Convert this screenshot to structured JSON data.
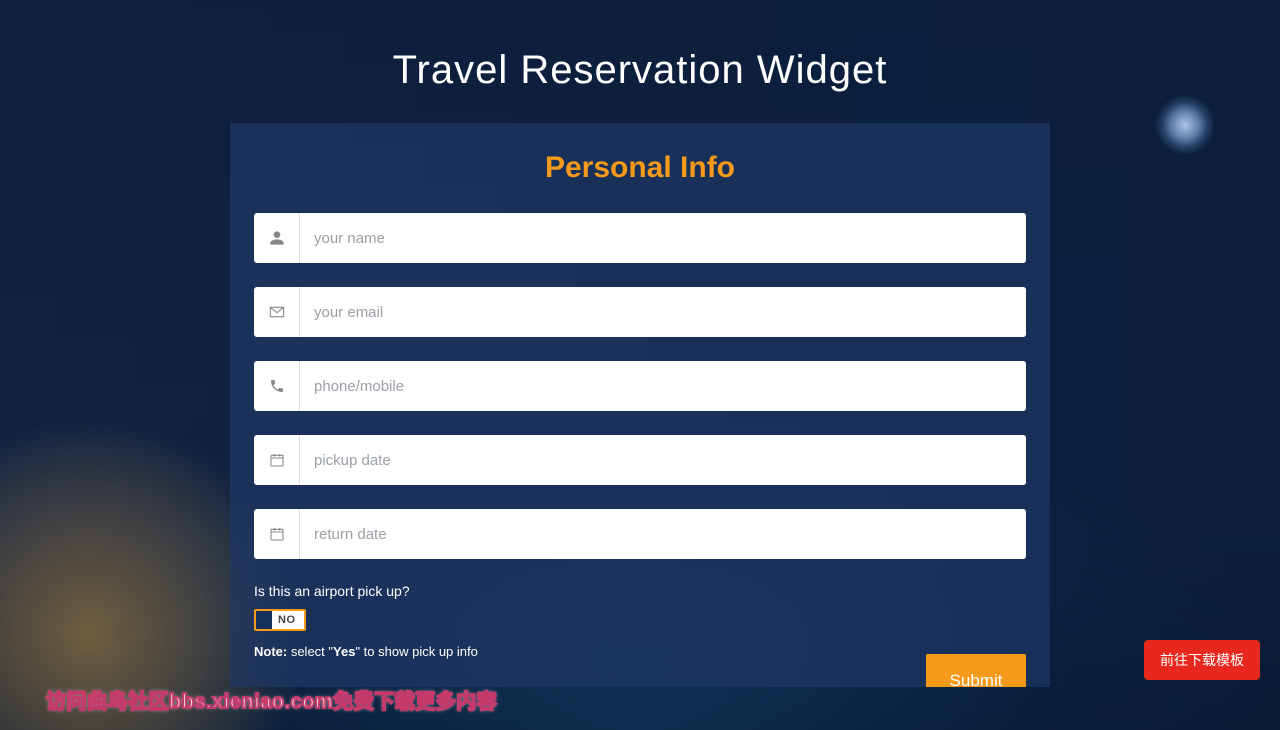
{
  "page": {
    "title": "Travel Reservation Widget"
  },
  "panel": {
    "title": "Personal Info"
  },
  "fields": {
    "name": {
      "placeholder": "your name",
      "value": ""
    },
    "email": {
      "placeholder": "your email",
      "value": ""
    },
    "phone": {
      "placeholder": "phone/mobile",
      "value": ""
    },
    "pickup": {
      "placeholder": "pickup date",
      "value": ""
    },
    "return": {
      "placeholder": "return date",
      "value": ""
    }
  },
  "airport": {
    "question": "Is this an airport pick up?",
    "state_label": "NO",
    "note_prefix": "Note:",
    "note_mid1": " select \"",
    "note_bold": "Yes",
    "note_mid2": "\" to show pick up info"
  },
  "actions": {
    "submit": "Submit"
  },
  "overlay": {
    "watermark": "访问曲鸟社区bbs.xieniao.com免费下载更多内容",
    "download_button": "前往下载模板"
  }
}
